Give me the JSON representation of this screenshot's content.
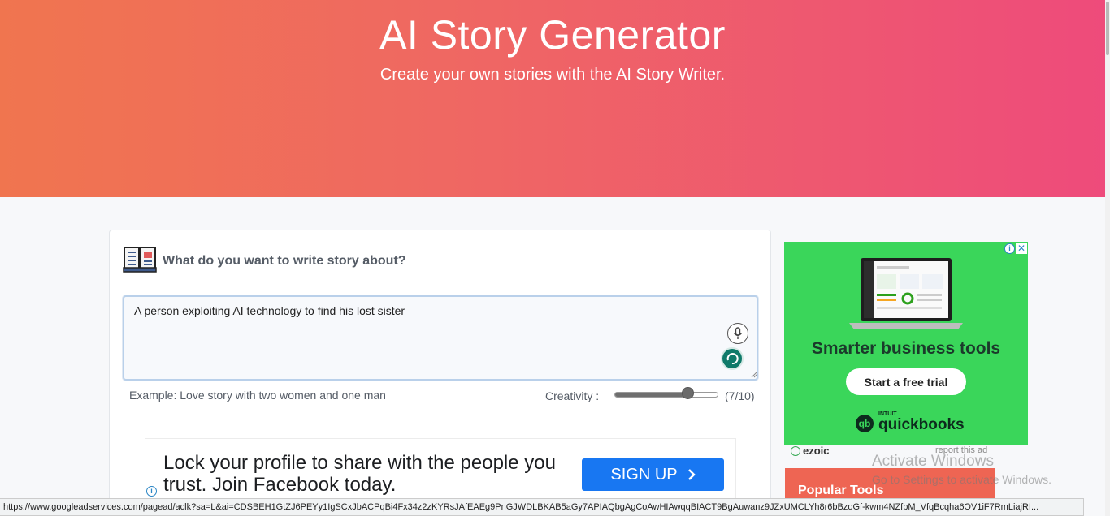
{
  "hero": {
    "title": "AI Story Generator",
    "subtitle": "Create your own stories with the AI Story Writer."
  },
  "form": {
    "question": "What do you want to write story about?",
    "input_value": "A person exploiting AI technology to find his lost sister",
    "example": "Example: Love story with two women and one man",
    "creativity_label": "Creativity :",
    "creativity_value_text": "(7/10)",
    "creativity_level": 0.7
  },
  "fb_ad": {
    "text": "Lock your profile to share with the people you trust. Join Facebook today.",
    "signup_label": "SIGN UP",
    "brand_color": "#1877f2"
  },
  "side_ad": {
    "headline": "Smarter business tools",
    "cta": "Start a free trial",
    "brand_small": "INTUIT",
    "brand": "quickbooks",
    "ezoic_label": "ezoic",
    "report_label": "report this ad"
  },
  "sidebar": {
    "popular_tools": "Popular Tools"
  },
  "watermark": {
    "title": "Activate Windows",
    "subtitle": "Go to Settings to activate Windows."
  },
  "status_bar": {
    "url": "https://www.googleadservices.com/pagead/aclk?sa=L&ai=CDSBEH1GtZJ6PEYy1IgSCxJbACPqBi4Fx34z2zKYRsJAfEAEg9PnGJWDLBKAB5aGy7APIAQbgAgCoAwHIAwqqBIACT9BgAuwanz9JZxUMCLYh8r6bBzoGf-kwm4NZfbM_VfqBcqha6OV1iF7RmLiajRI..."
  },
  "colors": {
    "hero_start": "#f0754f",
    "hero_end": "#ee4b7b",
    "ad_green": "#3ad65a",
    "popular_bg": "#ee6553"
  }
}
